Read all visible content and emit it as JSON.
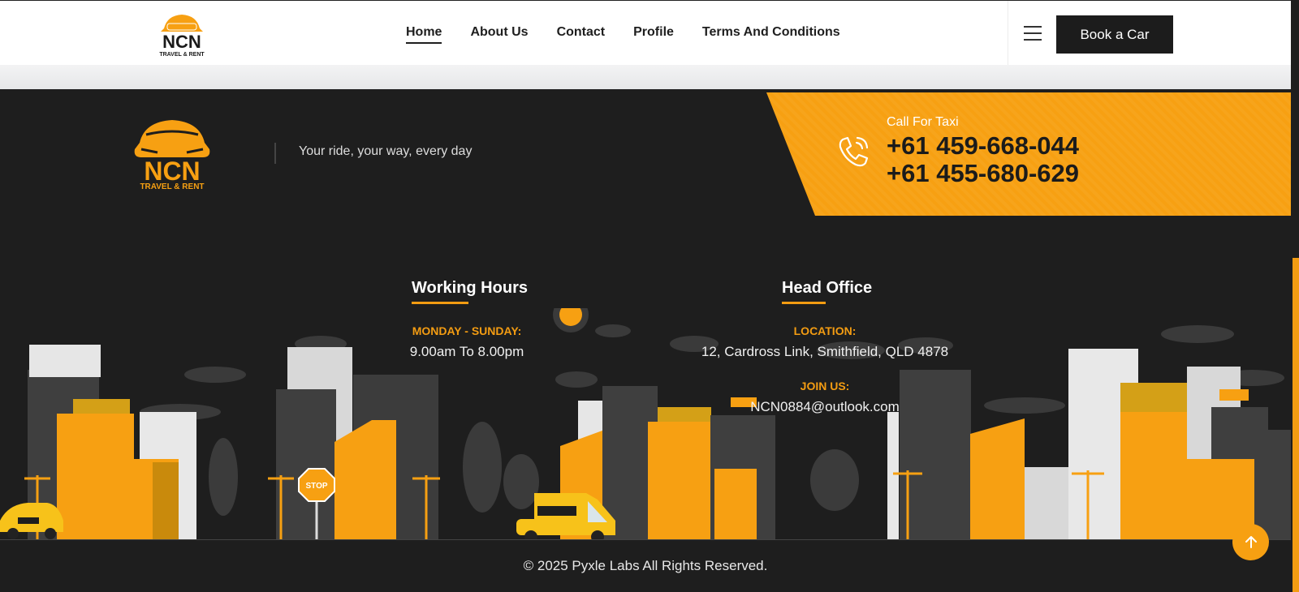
{
  "header": {
    "logo": {
      "icon": "car-logo-icon",
      "brand": "NCN",
      "sub": "TRAVEL & RENT"
    },
    "nav": [
      {
        "label": "Home",
        "active": true
      },
      {
        "label": "About Us"
      },
      {
        "label": "Contact"
      },
      {
        "label": "Profile"
      },
      {
        "label": "Terms And Conditions"
      }
    ],
    "menu_icon": "hamburger-icon",
    "cta_label": "Book a Car"
  },
  "footer": {
    "logo": {
      "icon": "car-logo-icon",
      "brand": "NCN",
      "sub": "TRAVEL & RENT"
    },
    "tagline": "Your ride, your way, every day",
    "call": {
      "icon": "phone-icon",
      "label": "Call For Taxi",
      "phones": [
        "+61 459-668-044",
        "+61 455-680-629"
      ]
    },
    "working_hours": {
      "title": "Working Hours",
      "label": "MONDAY - SUNDAY:",
      "value": "9.00am To 8.00pm"
    },
    "head_office": {
      "title": "Head Office",
      "location_label": "LOCATION:",
      "location_value": "12, Cardross Link, Smithfield, QLD 4878",
      "join_label": "JOIN US:",
      "join_value": "NCN0884@outlook.com"
    },
    "stop_sign": "STOP",
    "copyright": "© 2025 Pyxle Labs All Rights Reserved.",
    "back_to_top_icon": "arrow-up-icon"
  },
  "colors": {
    "accent": "#f7a012",
    "dark": "#1e1e1e",
    "button": "#1c1c1c"
  }
}
